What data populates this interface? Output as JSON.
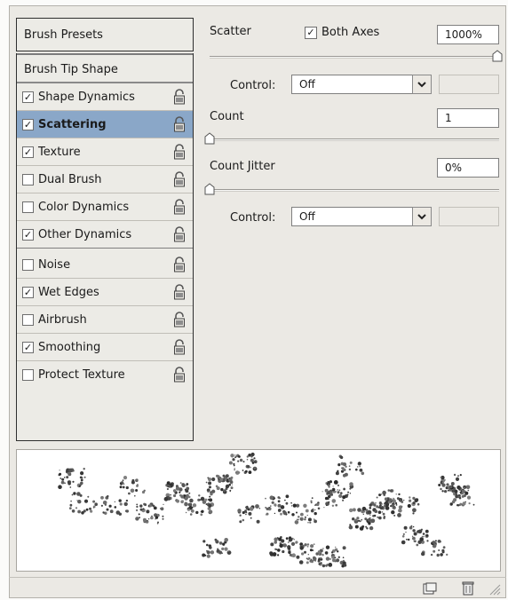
{
  "presets_label": "Brush Presets",
  "tip_shape_label": "Brush Tip Shape",
  "items": [
    {
      "label": "Shape Dynamics",
      "checked": true
    },
    {
      "label": "Scattering",
      "checked": true,
      "selected": true
    },
    {
      "label": "Texture",
      "checked": true
    },
    {
      "label": "Dual Brush",
      "checked": false
    },
    {
      "label": "Color Dynamics",
      "checked": false
    },
    {
      "label": "Other Dynamics",
      "checked": true
    },
    {
      "label": "Noise",
      "checked": false
    },
    {
      "label": "Wet Edges",
      "checked": true
    },
    {
      "label": "Airbrush",
      "checked": false
    },
    {
      "label": "Smoothing",
      "checked": true
    },
    {
      "label": "Protect Texture",
      "checked": false
    }
  ],
  "scatter": {
    "label": "Scatter",
    "both_axes_label": "Both Axes",
    "both_axes_checked": true,
    "value": "1000%",
    "level": 1.0,
    "control_label": "Control:",
    "control_value": "Off"
  },
  "count": {
    "label": "Count",
    "value": "1",
    "level": 0.0
  },
  "count_jitter": {
    "label": "Count Jitter",
    "value": "0%",
    "level": 0.0,
    "control_label": "Control:",
    "control_value": "Off"
  },
  "icons": {
    "lock": "lock-icon",
    "new": "new-preset-icon",
    "trash": "trash-icon"
  },
  "colors": {
    "selection": "#8aa7c8",
    "panel": "#ebe9e4"
  }
}
